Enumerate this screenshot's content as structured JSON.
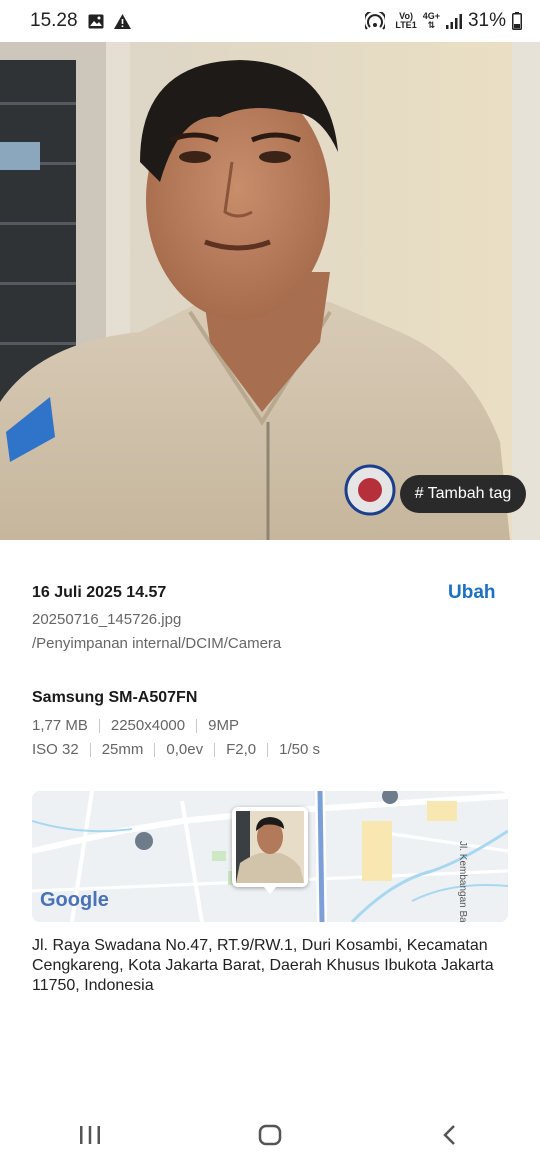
{
  "status_bar": {
    "time": "15.28",
    "volte_top": "Vo)",
    "volte_bottom": "LTE1",
    "network_top": "4G+",
    "network_bottom": "⇅",
    "battery_percent": "31%",
    "icons": [
      "gallery-icon",
      "warning-icon",
      "hotspot-icon",
      "signal-icon",
      "battery-icon"
    ]
  },
  "photo": {
    "tag_button_hash": "#",
    "tag_button_label": "Tambah tag"
  },
  "details": {
    "date": "16 Juli 2025 14.57",
    "edit_label": "Ubah",
    "filename": "20250716_145726.jpg",
    "path": "/Penyimpanan internal/DCIM/Camera",
    "device": "Samsung SM-A507FN",
    "file_info": [
      "1,77 MB",
      "2250x4000",
      "9MP"
    ],
    "camera_info": [
      "ISO 32",
      "25mm",
      "0,0ev",
      "F2,0",
      "1/50 s"
    ]
  },
  "map": {
    "logo": "Google",
    "street_label": "Jl. Kembangan Baru"
  },
  "address": "Jl. Raya Swadana No.47, RT.9/RW.1, Duri Kosambi, Kecamatan Cengkareng, Kota Jakarta Barat, Daerah Khusus Ibukota Jakarta 11750, Indonesia",
  "nav": {
    "icons": [
      "recent-apps-icon",
      "home-icon",
      "back-icon"
    ]
  }
}
